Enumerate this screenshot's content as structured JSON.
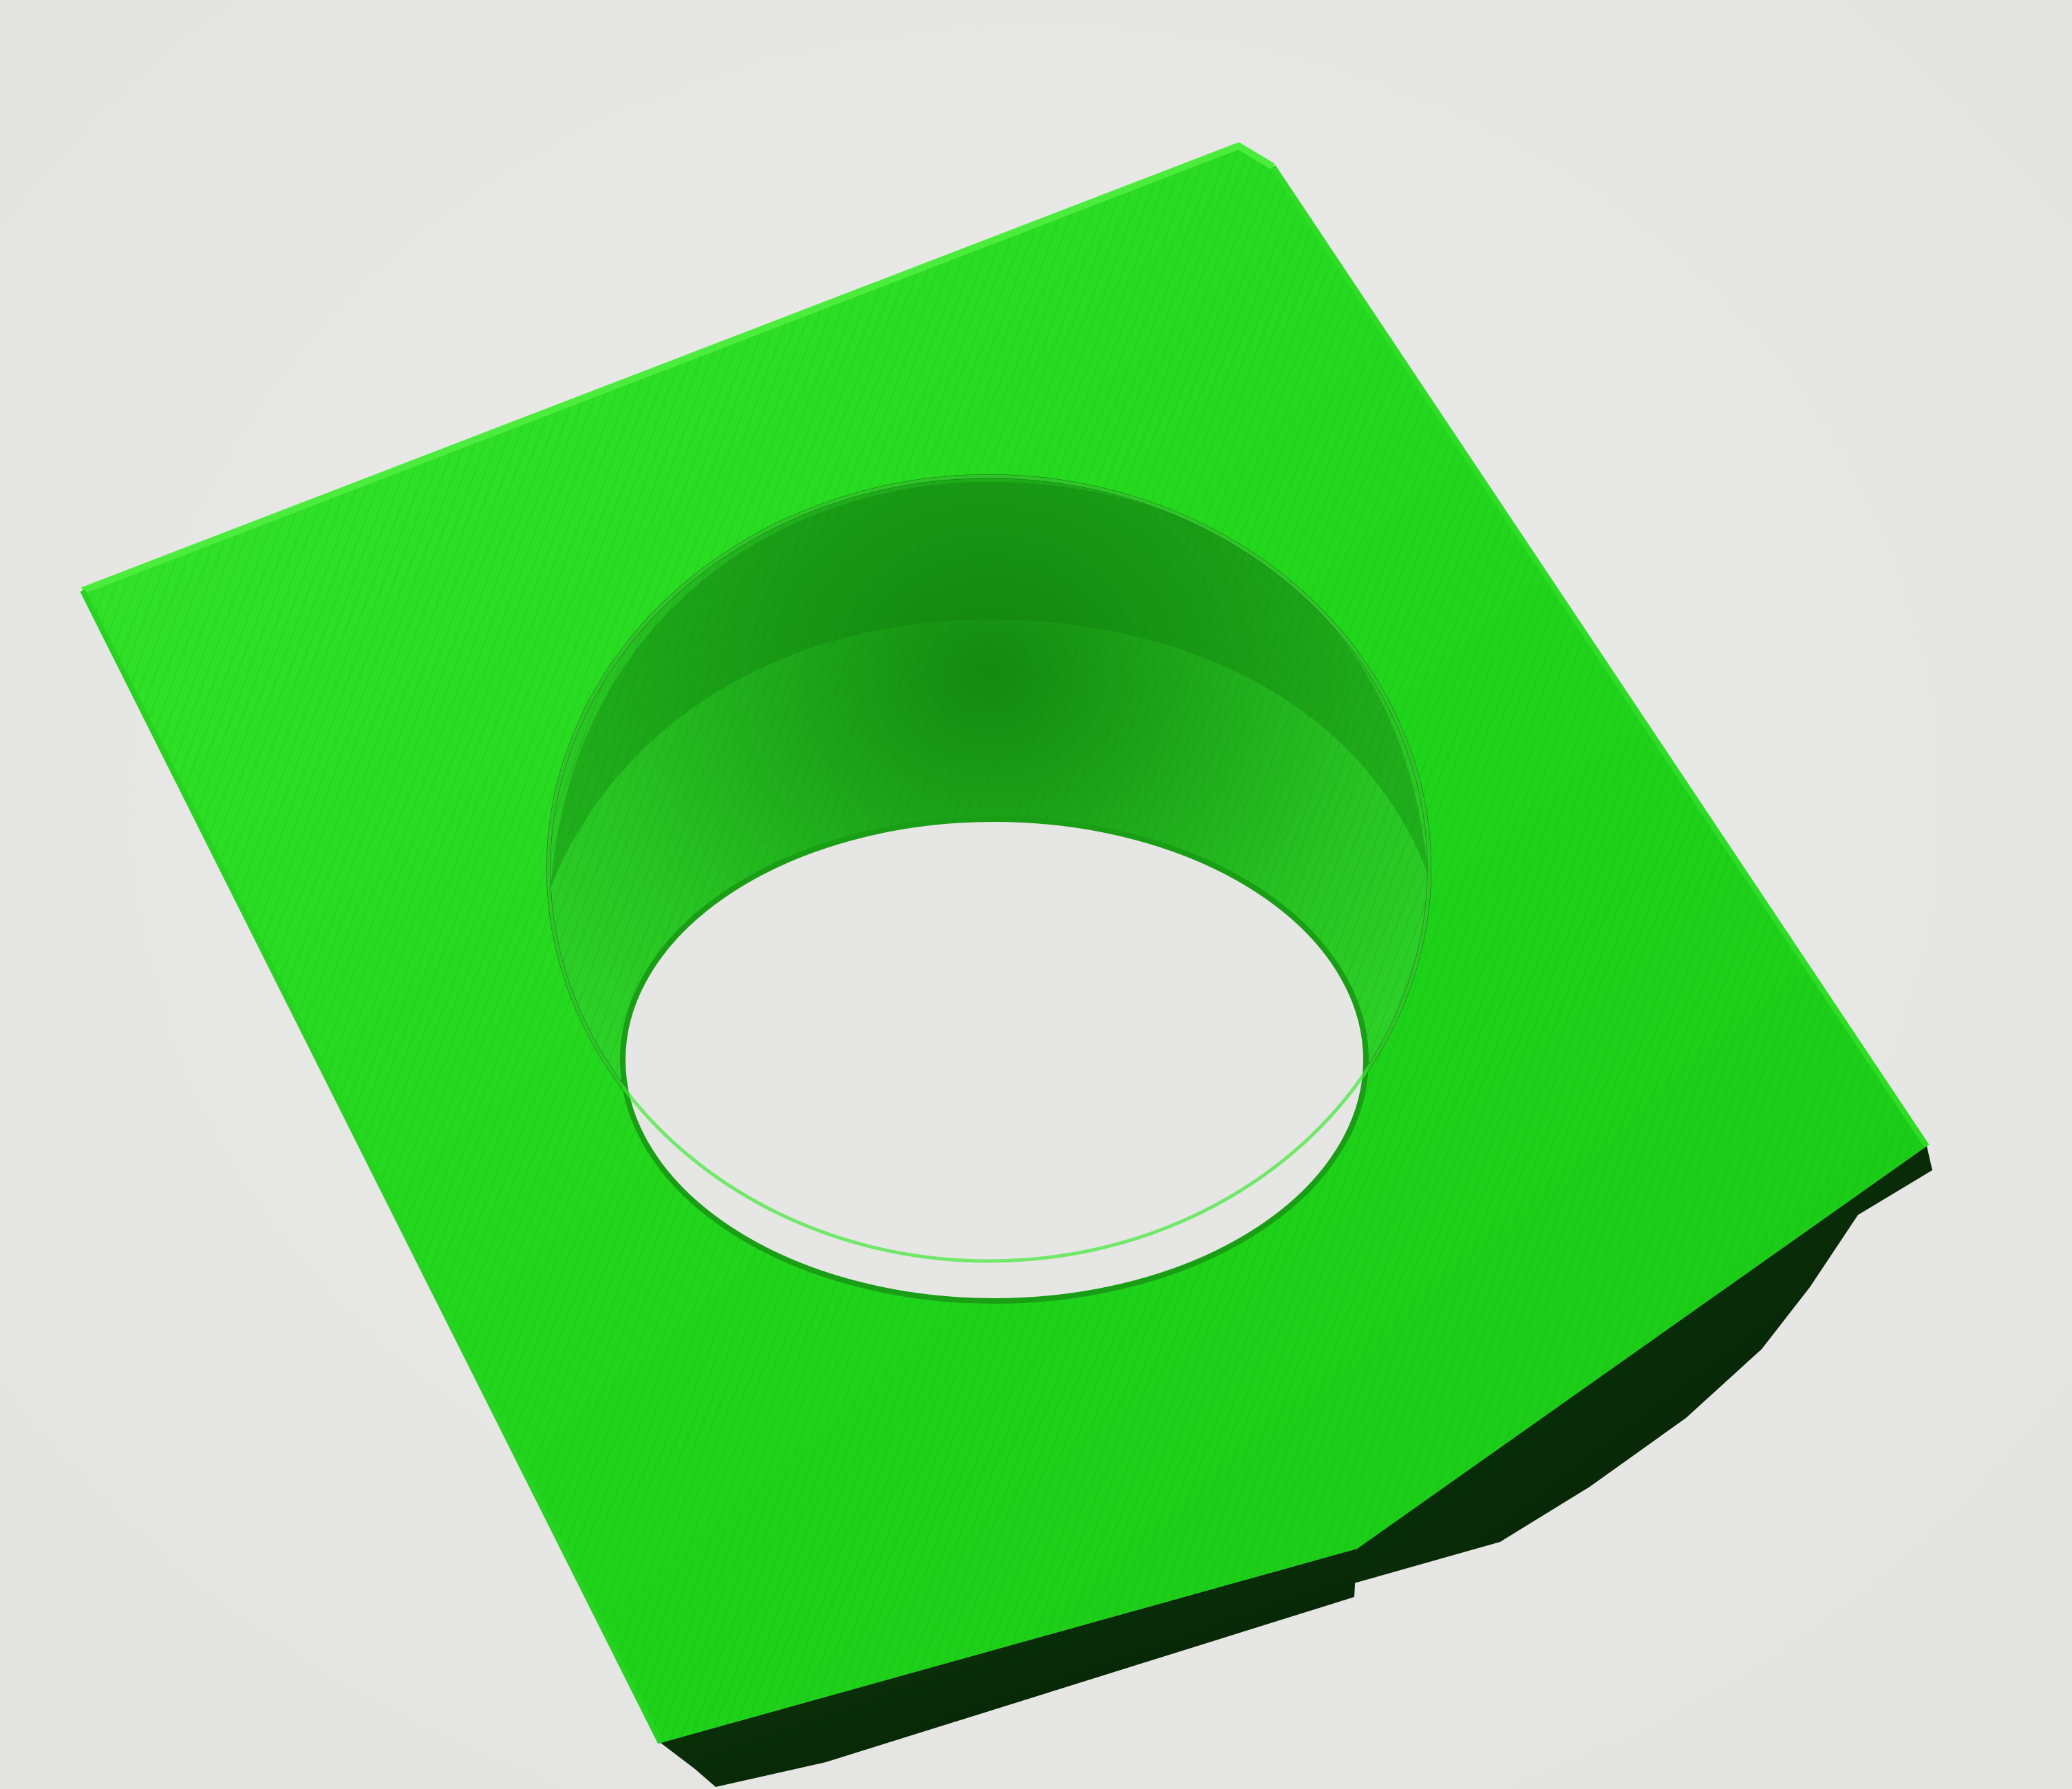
{
  "viewport": {
    "background_color": "#e2e2e0",
    "background_highlight_color": "#ececea"
  },
  "model": {
    "name": "",
    "shape": "square-block-with-through-hole",
    "top_face_color": "#1fd41a",
    "top_face_light_color": "#36e62c",
    "edge_highlight_color": "#4cec3e",
    "side_face_color": "#0d3d0b",
    "side_face_dark_color": "#051a04",
    "bore_wall_color": "#28c423",
    "bore_wall_shadow_color": "#138a10",
    "hole_background_color": "#e6e6e4",
    "icon": "green-block-3d-model"
  }
}
